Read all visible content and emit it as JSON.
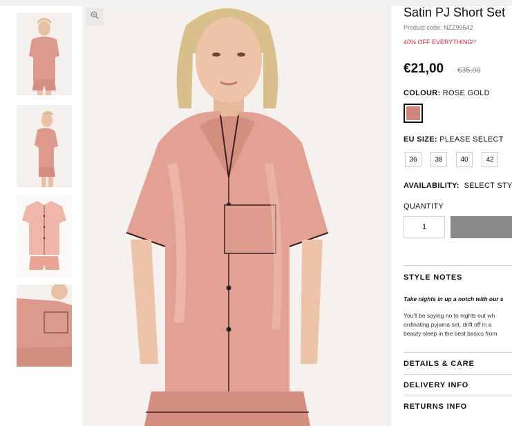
{
  "product": {
    "title": "Satin PJ Short Set",
    "product_code": "Product code: NZZ99542",
    "promo": "40% OFF EVERYTHING!*",
    "price": "€21,00",
    "was_price": "€35,00"
  },
  "colour": {
    "label": "COLOUR:",
    "value": "ROSE GOLD",
    "swatch_color": "#d0867c"
  },
  "size": {
    "label": "EU SIZE:",
    "value": "PLEASE SELECT",
    "options": [
      "36",
      "38",
      "40",
      "42"
    ]
  },
  "availability": {
    "label": "AVAILABILITY:",
    "value": "SELECT STYLE"
  },
  "quantity": {
    "label": "QUANTITY",
    "value": "1"
  },
  "style_notes": {
    "heading": "STYLE NOTES",
    "tagline": "Take nights in up a notch with our s",
    "body": [
      "You'll be saying no to nights out wh",
      "ordinating pyjama set, drift off in a",
      "beauty sleep in the best basics from"
    ]
  },
  "accordion": {
    "details": "DETAILS & CARE",
    "delivery": "DELIVERY INFO",
    "returns": "RETURNS INFO"
  },
  "colors": {
    "satin": "#e2a193",
    "promo": "#e0262b",
    "button": "#8a8a8a"
  },
  "icons": {
    "zoom": "magnifier-icon"
  }
}
